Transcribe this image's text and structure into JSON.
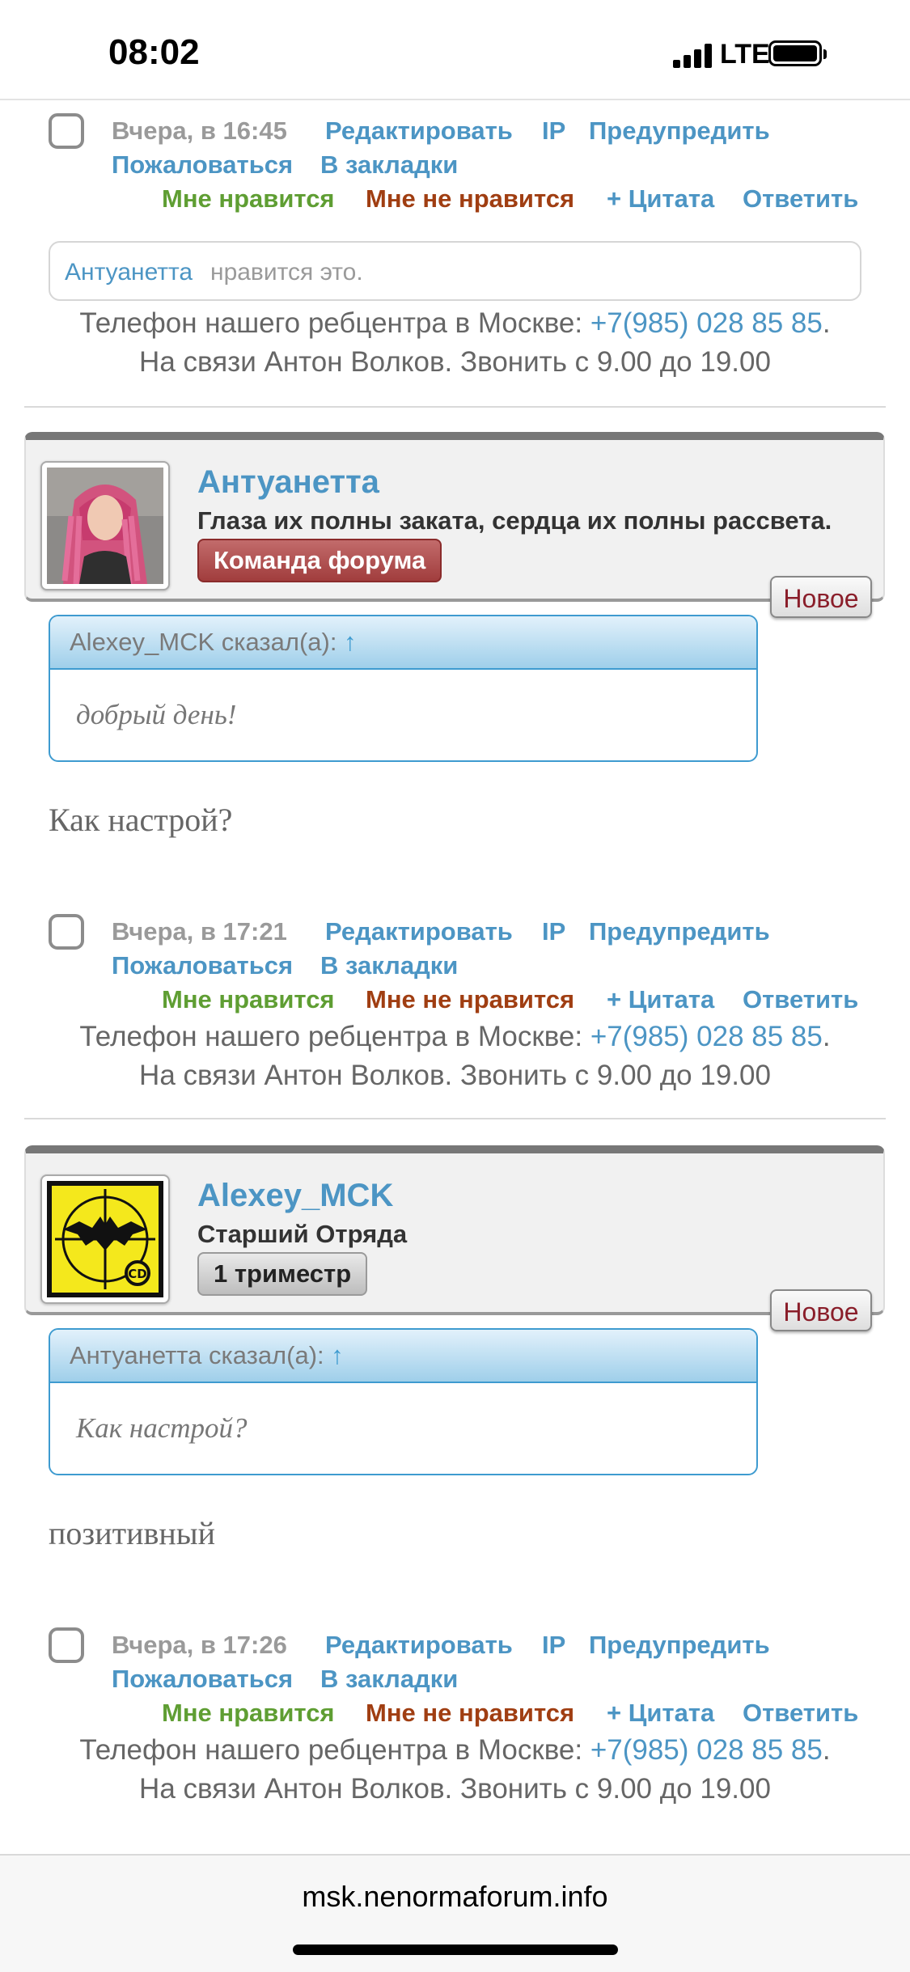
{
  "status_bar": {
    "time": "08:02",
    "network": "LTE"
  },
  "post_actions": {
    "edit": "Редактировать",
    "ip": "IP",
    "warn": "Предупредить",
    "report": "Пожаловаться",
    "bookmark": "В закладки",
    "like": "Мне нравится",
    "dislike": "Мне не нравится",
    "quote": "+ Цитата",
    "reply": "Ответить"
  },
  "signature": {
    "line1_text": "Телефон нашего ребцентра в Москве: ",
    "phone": "+7(985) 028 85 85",
    "period": ".",
    "line2": "На связи Антон Волков. Звонить с 9.00 до 19.00"
  },
  "posts": [
    {
      "date": "Вчера, в 16:45",
      "likes": {
        "user": "Антуанетта",
        "text": "нравится это."
      }
    },
    {
      "author": "Антуанетта",
      "user_title": "Глаза их полны заката, сердца их полны рассвета.",
      "rank": "Команда форума",
      "badge": "Новое",
      "quote": {
        "author": "Alexey_MCK сказал(а):",
        "arrow": "↑",
        "text": "добрый день!"
      },
      "message": "Как настрой?",
      "date": "Вчера, в 17:21"
    },
    {
      "author": "Alexey_MCK",
      "user_title": "Старший Отряда",
      "rank": "1 триместр",
      "badge": "Новое",
      "quote": {
        "author": "Антуанетта сказал(а):",
        "arrow": "↑",
        "text": "Как настрой?"
      },
      "message": "позитивный",
      "date": "Вчера, в 17:26"
    }
  ],
  "browser": {
    "url": "msk.nenormaforum.info"
  }
}
